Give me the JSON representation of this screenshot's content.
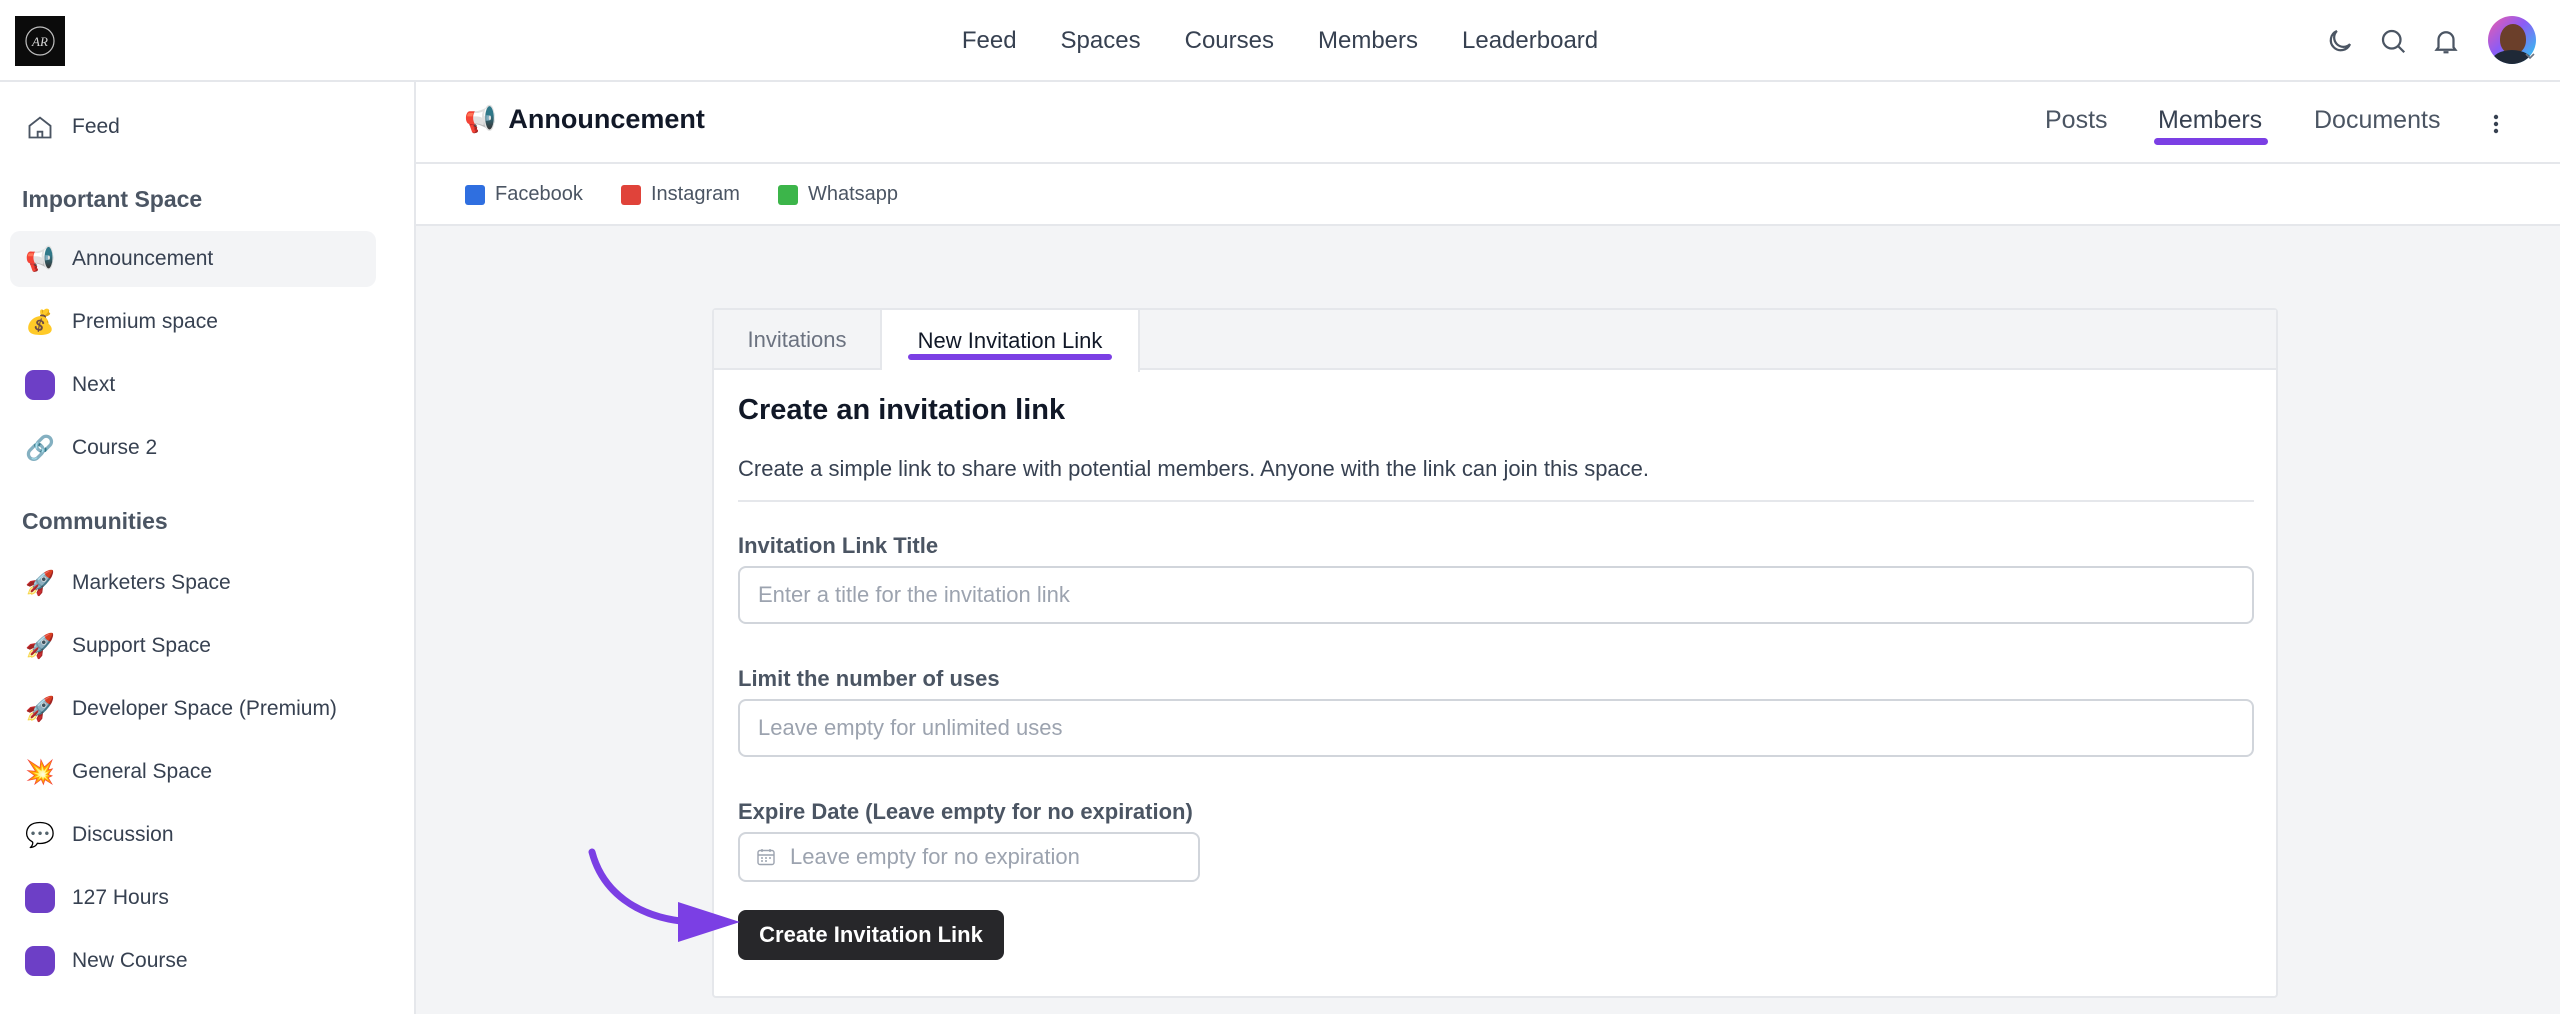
{
  "topnav": {
    "items": [
      "Feed",
      "Spaces",
      "Courses",
      "Members",
      "Leaderboard"
    ]
  },
  "brand": {
    "logo_text": "AR"
  },
  "sidebar": {
    "top_items": [
      {
        "label": "Feed",
        "icon": "home-icon"
      }
    ],
    "sections": [
      {
        "heading": "Important Space",
        "items": [
          {
            "label": "Announcement",
            "icon": "megaphone-icon",
            "glyph": "📢",
            "active": true
          },
          {
            "label": "Premium space",
            "icon": "money-bag-icon",
            "glyph": "💰"
          },
          {
            "label": "Next",
            "icon": "purple-dot-icon"
          },
          {
            "label": "Course 2",
            "icon": "link-icon",
            "glyph": "🔗"
          }
        ]
      },
      {
        "heading": "Communities",
        "items": [
          {
            "label": "Marketers Space",
            "icon": "rocket-icon",
            "glyph": "🚀"
          },
          {
            "label": "Support Space",
            "icon": "rocket-icon",
            "glyph": "🚀"
          },
          {
            "label": "Developer Space (Premium)",
            "icon": "rocket-icon",
            "glyph": "🚀"
          },
          {
            "label": "General Space",
            "icon": "collision-icon",
            "glyph": "💥"
          },
          {
            "label": "Discussion",
            "icon": "speech-bubble-icon",
            "glyph": "💬"
          },
          {
            "label": "127 Hours",
            "icon": "purple-dot-icon"
          },
          {
            "label": "New Course",
            "icon": "purple-dot-icon"
          }
        ]
      }
    ]
  },
  "space": {
    "title": "Announcement",
    "tabs": [
      "Posts",
      "Members",
      "Documents"
    ],
    "active_tab": "Members",
    "links": [
      {
        "label": "Facebook",
        "color": "#2f6fe0"
      },
      {
        "label": "Instagram",
        "color": "#e0433a"
      },
      {
        "label": "Whatsapp",
        "color": "#3cb54a"
      }
    ]
  },
  "invite": {
    "tabs": [
      "Invitations",
      "New Invitation Link"
    ],
    "active_tab": "New Invitation Link",
    "heading": "Create an invitation link",
    "description": "Create a simple link to share with potential members. Anyone with the link can join this space.",
    "title_label": "Invitation Link Title",
    "title_placeholder": "Enter a title for the invitation link",
    "limit_label": "Limit the number of uses",
    "limit_placeholder": "Leave empty for unlimited uses",
    "expire_label": "Expire Date (Leave empty for no expiration)",
    "expire_placeholder": "Leave empty for no expiration",
    "submit_label": "Create Invitation Link"
  },
  "colors": {
    "accent": "#7b3fe4",
    "button": "#27272a",
    "dot": "#6d3fc6"
  }
}
